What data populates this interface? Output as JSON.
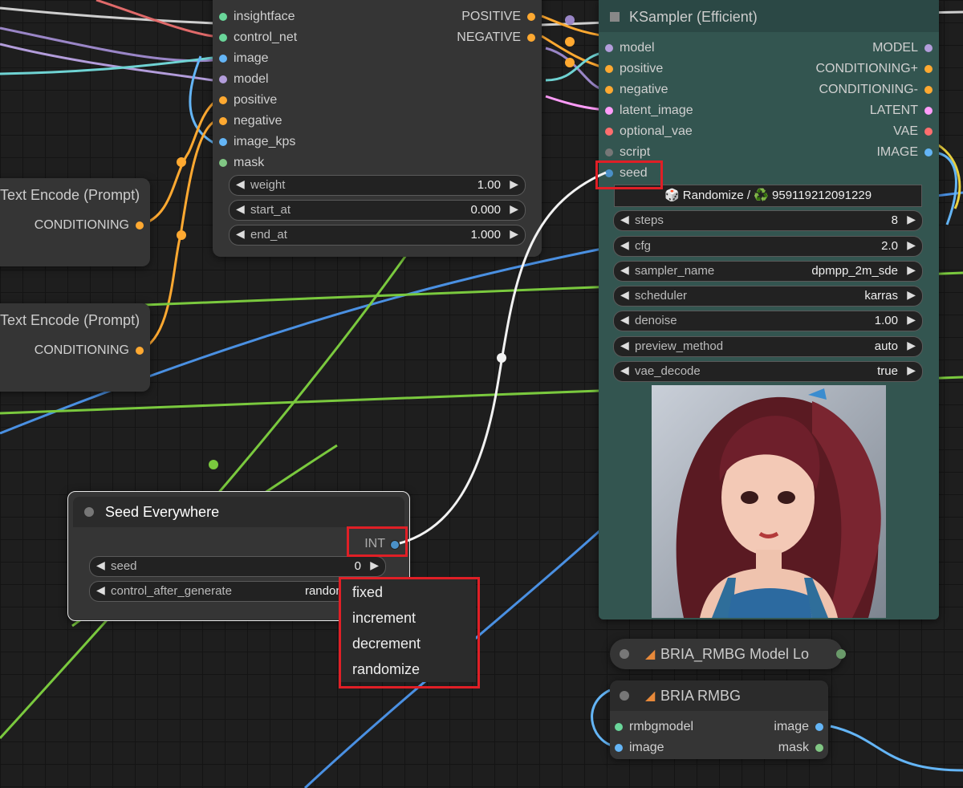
{
  "apply_node": {
    "inputs": [
      "insightface",
      "control_net",
      "image",
      "model",
      "positive",
      "negative",
      "image_kps",
      "mask"
    ],
    "outputs": [
      "POSITIVE",
      "NEGATIVE"
    ],
    "widgets": [
      {
        "label": "weight",
        "value": "1.00"
      },
      {
        "label": "start_at",
        "value": "0.000"
      },
      {
        "label": "end_at",
        "value": "1.000"
      }
    ]
  },
  "text_encode_nodes": [
    {
      "title": "Text Encode (Prompt)",
      "output": "CONDITIONING"
    },
    {
      "title": "Text Encode (Prompt)",
      "output": "CONDITIONING"
    }
  ],
  "ksampler": {
    "title": "KSampler (Efficient)",
    "inputs": [
      "model",
      "positive",
      "negative",
      "latent_image",
      "optional_vae",
      "script",
      "seed"
    ],
    "outputs": [
      "MODEL",
      "CONDITIONING+",
      "CONDITIONING-",
      "LATENT",
      "VAE",
      "IMAGE"
    ],
    "seed_button": "🎲 Randomize / ♻️ 959119212091229",
    "widgets": [
      {
        "label": "steps",
        "value": "8"
      },
      {
        "label": "cfg",
        "value": "2.0"
      },
      {
        "label": "sampler_name",
        "value": "dpmpp_2m_sde"
      },
      {
        "label": "scheduler",
        "value": "karras"
      },
      {
        "label": "denoise",
        "value": "1.00"
      },
      {
        "label": "preview_method",
        "value": "auto"
      },
      {
        "label": "vae_decode",
        "value": "true"
      }
    ]
  },
  "seed_node": {
    "title": "Seed Everywhere",
    "output": "INT",
    "widgets": [
      {
        "label": "seed",
        "value": "0"
      },
      {
        "label": "control_after_generate",
        "value": "randomize"
      }
    ]
  },
  "dropdown": {
    "options": [
      "fixed",
      "increment",
      "decrement",
      "randomize"
    ]
  },
  "bria_loader": {
    "title": "BRIA_RMBG Model Lo"
  },
  "bria_node": {
    "title": "BRIA RMBG",
    "inputs": [
      "rmbgmodel",
      "image"
    ],
    "outputs": [
      "image",
      "mask"
    ]
  },
  "colors": {
    "model": "#b39ddb",
    "conditioning": "#ffa931",
    "image": "#64b5f6",
    "latent": "#ff9cf9",
    "vae": "#ff6e6e",
    "int": "#4a90c8",
    "green": "#7ac93e",
    "highlight": "#e01f26",
    "ksampler_bg": "#335550"
  }
}
